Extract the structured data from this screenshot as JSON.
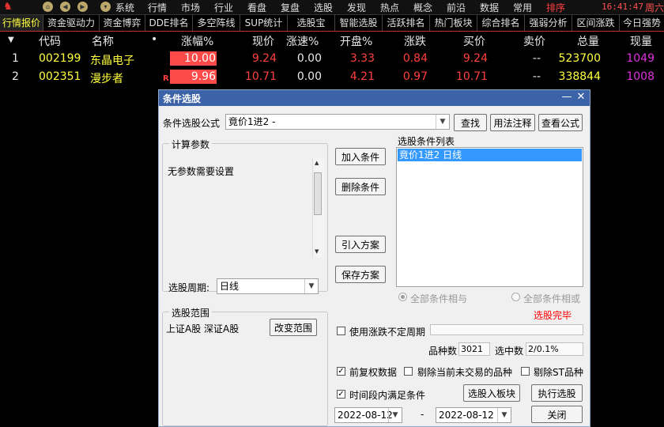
{
  "menubar": {
    "items": [
      "系统",
      "行情",
      "市场",
      "行业",
      "看盘",
      "复盘",
      "选股",
      "发现",
      "热点",
      "概念",
      "前沿",
      "数据",
      "常用",
      "排序"
    ],
    "clock": "16:41:47",
    "week": "周六"
  },
  "tabs": [
    "行情报价",
    "资金驱动力",
    "资金博弈",
    "DDE排名",
    "多空阵线",
    "SUP统计",
    "选股宝",
    "智能选股",
    "活跃排名",
    "热门板块",
    "综合排名",
    "强弱分析",
    "区间涨跌",
    "今日强势"
  ],
  "table": {
    "headers": [
      "代码",
      "名称",
      "•",
      "涨幅%",
      "现价",
      "涨速%",
      "开盘%",
      "涨跌",
      "买价",
      "卖价",
      "总量",
      "现量"
    ],
    "rows": [
      {
        "index": "1",
        "code": "002199",
        "name": "东晶电子",
        "flag": "",
        "pct": "10.00",
        "price": "9.24",
        "speed": "0.00",
        "open": "3.33",
        "change": "0.84",
        "bid": "9.24",
        "ask": "--",
        "volume": "523700",
        "lastvol": "1049"
      },
      {
        "index": "2",
        "code": "002351",
        "name": "漫步者",
        "flag": "R",
        "pct": "9.96",
        "price": "10.71",
        "speed": "0.00",
        "open": "4.21",
        "change": "0.97",
        "bid": "10.71",
        "ask": "--",
        "volume": "338844",
        "lastvol": "1008"
      }
    ]
  },
  "dialog": {
    "title": "条件选股",
    "formula_label": "条件选股公式",
    "formula_value": "竟价1进2       -",
    "find_button": "查找",
    "usage_button": "用法注释",
    "view_formula_button": "查看公式",
    "params_group": "计算参数",
    "params_text": "无参数需要设置",
    "period_label": "选股周期:",
    "period_value": "日线",
    "scope_group": "选股范围",
    "scope_text": "上证A股 深证A股",
    "change_scope_button": "改变范围",
    "add_condition_button": "加入条件",
    "delete_condition_button": "删除条件",
    "import_plan_button": "引入方案",
    "save_plan_button": "保存方案",
    "condition_list_label": "选股条件列表",
    "condition_list_item": "竟价1进2  日线",
    "radio_and": "全部条件相与",
    "radio_or": "全部条件相或",
    "status": "选股完毕",
    "use_pct_label": "使用涨跌不定周期",
    "stock_count_label": "品种数",
    "stock_count_value": "3021",
    "selected_count_label": "选中数",
    "selected_count_value": "2/0.1%",
    "adjust_label": "前复权数据",
    "exclude_untraded_label": "剔除当前未交易的品种",
    "exclude_st_label": "剔除ST品种",
    "time_range_label": "时间段内满足条件",
    "to_board_button": "选股入板块",
    "execute_button": "执行选股",
    "date_from": "2022-08-12",
    "date_dash": "-",
    "date_to": "2022-08-12",
    "close_button": "关闭"
  },
  "colors": {
    "up": "#ff4040",
    "code": "#ffff40",
    "lastvol": "#e030e0",
    "dialog_title": "#3c62a8",
    "status": "#ff0000"
  }
}
